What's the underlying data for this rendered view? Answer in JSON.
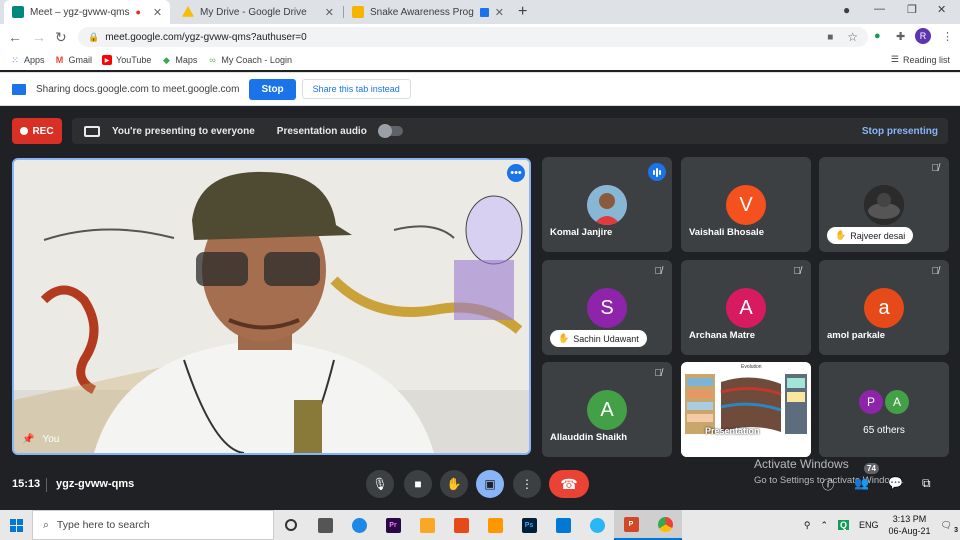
{
  "browser": {
    "tabs": [
      {
        "title": "Meet – ygz-gvww-qms",
        "fav_color": "#00897b",
        "recording": true
      },
      {
        "title": "My Drive - Google Drive",
        "fav_color": "#fbbc04"
      },
      {
        "title": "Snake Awareness ProgramFi",
        "fav_color": "#f4b400"
      }
    ],
    "url": "meet.google.com/ygz-gvww-qms?authuser=0",
    "profile_initial": "R",
    "bookmarks": [
      {
        "label": "Apps",
        "icon": "apps-grid-icon"
      },
      {
        "label": "Gmail",
        "icon": "gmail-icon"
      },
      {
        "label": "YouTube",
        "icon": "youtube-icon"
      },
      {
        "label": "Maps",
        "icon": "maps-icon"
      },
      {
        "label": "My Coach - Login",
        "icon": "coach-icon"
      }
    ],
    "reading_list": "Reading list"
  },
  "sharebar": {
    "text": "Sharing docs.google.com to meet.google.com",
    "stop_label": "Stop",
    "share_tab_label": "Share this tab instead"
  },
  "meet": {
    "rec_label": "REC",
    "presenting_text": "You're presenting to everyone",
    "presentation_audio": "Presentation audio",
    "stop_presenting": "Stop presenting",
    "self_label": "You",
    "participants": [
      {
        "name": "Komal Janjire",
        "type": "photo",
        "status": "speaking"
      },
      {
        "name": "Vaishali Bhosale",
        "initial": "V",
        "color": "#f4511e",
        "status": "normal"
      },
      {
        "name": "Rajveer desai",
        "type": "photo",
        "status": "muted",
        "pill": true
      },
      {
        "name": "Sachin Udawant",
        "initial": "S",
        "color": "#8e24aa",
        "status": "muted",
        "pill": true
      },
      {
        "name": "Archana Matre",
        "initial": "A",
        "color": "#d81b60",
        "status": "muted"
      },
      {
        "name": "amol parkale",
        "initial": "a",
        "color": "#e64a19",
        "status": "muted"
      },
      {
        "name": "Allauddin Shaikh",
        "initial": "A",
        "color": "#43a047",
        "status": "muted"
      }
    ],
    "presentation_tile_label": "Presentation",
    "presentation_slide_title": "Evolution",
    "others": {
      "label": "65 others",
      "avatars": [
        {
          "initial": "P",
          "color": "#8e24aa"
        },
        {
          "initial": "A",
          "color": "#43a047"
        }
      ]
    },
    "time": "15:13",
    "meeting_code": "ygz-gvww-qms",
    "activate_line1": "Activate Windows",
    "activate_line2": "Go to Settings to activate Windows.",
    "participants_badge": "74"
  },
  "taskbar": {
    "search_placeholder": "Type here to search",
    "apps": [
      {
        "name": "task-view-icon",
        "label": "",
        "color": "#333"
      },
      {
        "name": "edge-icon",
        "label": "",
        "color": "#1e88e5"
      },
      {
        "name": "premiere-icon",
        "label": "Pr",
        "color": "#2a0845"
      },
      {
        "name": "file-explorer-icon",
        "label": "",
        "color": "#f9a825"
      },
      {
        "name": "office-icon",
        "label": "",
        "color": "#e64a19"
      },
      {
        "name": "sketch-icon",
        "label": "",
        "color": "#ff9800"
      },
      {
        "name": "photoshop-icon",
        "label": "Ps",
        "color": "#001e36"
      },
      {
        "name": "store-icon",
        "label": "",
        "color": "#0078d4"
      },
      {
        "name": "telegram-icon",
        "label": "",
        "color": "#29b6f6"
      },
      {
        "name": "powerpoint-icon",
        "label": "P",
        "color": "#d24726"
      },
      {
        "name": "chrome-icon",
        "label": "",
        "color": "#4285f4"
      }
    ],
    "language": "ENG",
    "time": "3:13 PM",
    "date": "06-Aug-21",
    "notification_count": "3"
  }
}
